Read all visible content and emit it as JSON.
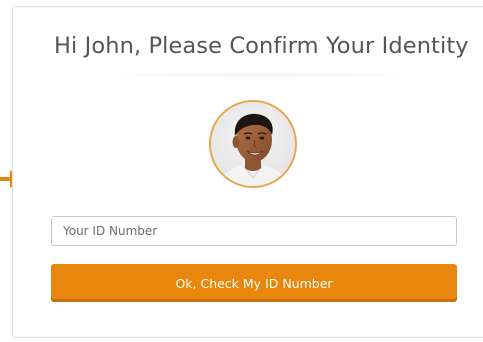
{
  "header": {
    "title": "Hi John, Please Confirm Your Identity"
  },
  "avatar": {
    "icon": "user-photo",
    "ring_color": "#e8a44a"
  },
  "form": {
    "id_placeholder": "Your ID Number",
    "id_value": "",
    "submit_label": "Ok, Check My ID Number"
  },
  "colors": {
    "accent": "#e8870c",
    "pointer_arrow": "#e8870c",
    "title_text": "#555555"
  },
  "pointer": {
    "icon": "arrow-right-icon"
  }
}
